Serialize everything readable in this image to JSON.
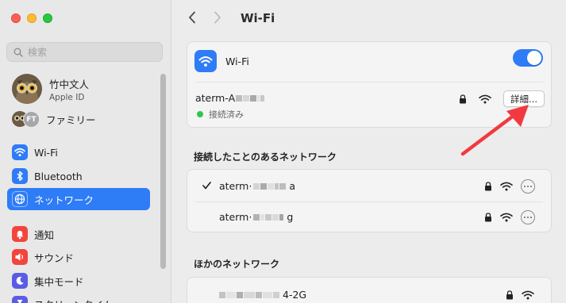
{
  "window": {
    "title": "Wi-Fi"
  },
  "sidebar": {
    "search_placeholder": "検索",
    "profile": {
      "name": "竹中文人",
      "subtitle": "Apple ID"
    },
    "family": {
      "initials": "FT",
      "label": "ファミリー"
    },
    "items": [
      {
        "label": "Wi-Fi",
        "icon": "wifi-icon",
        "color": "#2e7cf6"
      },
      {
        "label": "Bluetooth",
        "icon": "bluetooth-icon",
        "color": "#2e7cf6"
      },
      {
        "label": "ネットワーク",
        "icon": "globe-icon",
        "color": "#2e7cf6",
        "active": true
      },
      {
        "label": "通知",
        "icon": "bell-icon",
        "color": "#f2453d"
      },
      {
        "label": "サウンド",
        "icon": "speaker-icon",
        "color": "#f2453d"
      },
      {
        "label": "集中モード",
        "icon": "moon-icon",
        "color": "#5b5ce6"
      },
      {
        "label": "スクリーンタイム",
        "icon": "hourglass-icon",
        "color": "#5b5ce6"
      }
    ]
  },
  "wifi": {
    "label": "Wi-Fi",
    "enabled": true,
    "current_network": {
      "name_prefix": "aterm-A",
      "status": "接続済み",
      "details_button": "詳細..."
    }
  },
  "known_networks": {
    "heading": "接続したことのあるネットワーク",
    "items": [
      {
        "prefix": "aterm·",
        "suffix": "a",
        "checked": true
      },
      {
        "prefix": "aterm·",
        "suffix": "g",
        "checked": false
      }
    ]
  },
  "other_networks": {
    "heading": "ほかのネットワーク",
    "items": [
      {
        "suffix": "4-2G"
      }
    ]
  },
  "colors": {
    "accent": "#2e7cf6",
    "connected": "#30c64c",
    "annotation_arrow": "#f03a3f"
  }
}
